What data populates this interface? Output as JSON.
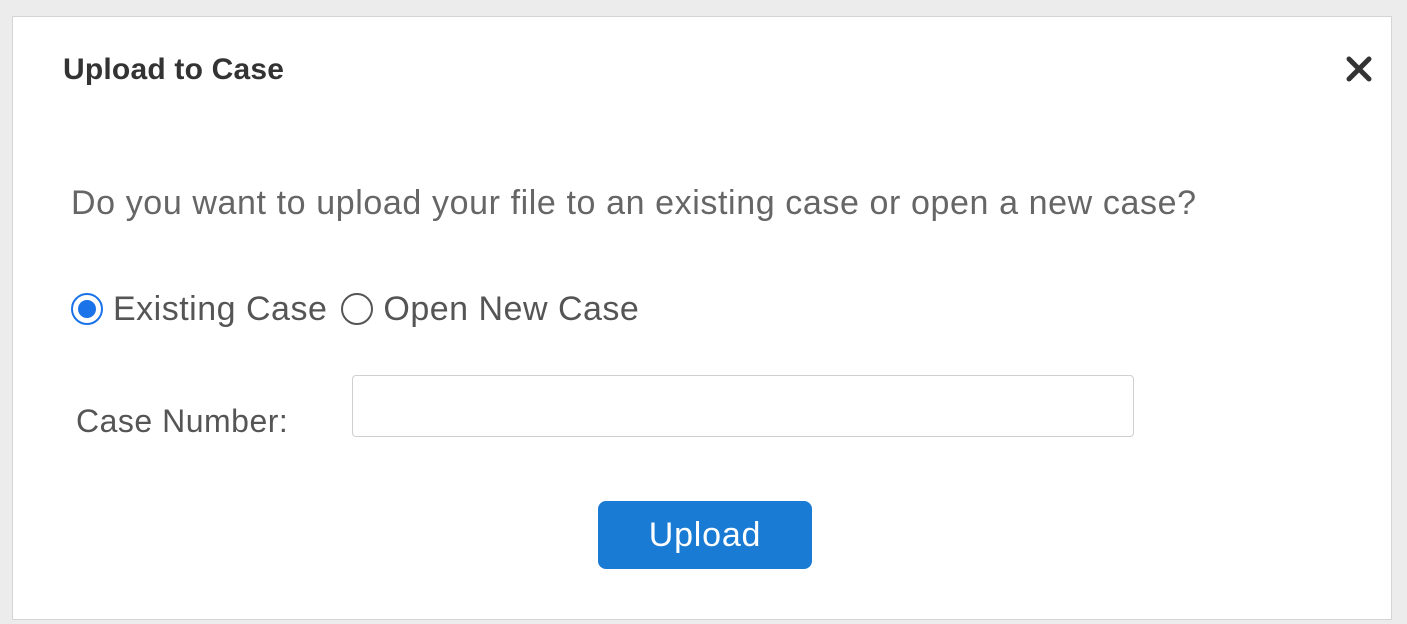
{
  "dialog": {
    "title": "Upload to Case",
    "close_icon": "close-icon",
    "question": "Do you want to upload your file to an existing case or open a new case?",
    "options": [
      {
        "label": "Existing Case",
        "selected": true
      },
      {
        "label": "Open New Case",
        "selected": false
      }
    ],
    "case_number": {
      "label": "Case Number:",
      "value": "",
      "placeholder": ""
    },
    "upload_label": "Upload"
  },
  "colors": {
    "accent": "#1a73e8",
    "button": "#1a7bd4",
    "title_text": "#333333",
    "body_text": "#666666"
  }
}
